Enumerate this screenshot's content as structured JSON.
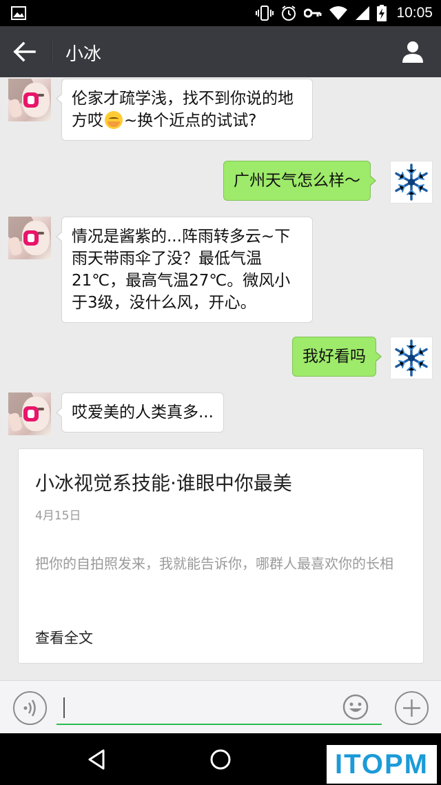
{
  "status_bar": {
    "time": "10:05",
    "icons": [
      "image-icon",
      "vibrate-icon",
      "alarm-icon",
      "key-icon",
      "wifi-icon",
      "signal-icon",
      "battery-charging-icon"
    ]
  },
  "header": {
    "title": "小冰",
    "back_icon": "back-arrow-icon",
    "profile_icon": "person-icon"
  },
  "messages": [
    {
      "from": "bot",
      "text_before": "伦家才疏学浅，找不到你说的地方哎",
      "emoji": "embarrassed-face",
      "text_after": "~换个近点的试试?"
    },
    {
      "from": "me",
      "text": "广州天气怎么样～"
    },
    {
      "from": "bot",
      "text": "情况是酱紫的...阵雨转多云~下雨天带雨伞了没？最低气温21℃，最高气温27℃。微风小于3级，没什么风，开心。"
    },
    {
      "from": "me",
      "text": "我好看吗"
    },
    {
      "from": "bot",
      "text": "哎爱美的人类真多..."
    }
  ],
  "card": {
    "title": "小冰视觉系技能·谁眼中你最美",
    "date": "4月15日",
    "description": "把你的自拍照发来，我就能告诉你，哪群人最喜欢你的长相",
    "read_more": "查看全文"
  },
  "input_bar": {
    "voice_icon": "voice-icon",
    "input_value": "",
    "emoji_icon": "smiley-icon",
    "plus_icon": "plus-icon",
    "accent_color": "#2bbc54"
  },
  "nav_bar": {
    "icons": [
      "nav-back-icon",
      "nav-home-icon"
    ]
  },
  "watermark": {
    "text": "ITOPM"
  },
  "colors": {
    "header_bg": "#393a3f",
    "chat_bg": "#ebebeb",
    "out_bubble": "#9eea6a",
    "in_bubble": "#ffffff"
  }
}
